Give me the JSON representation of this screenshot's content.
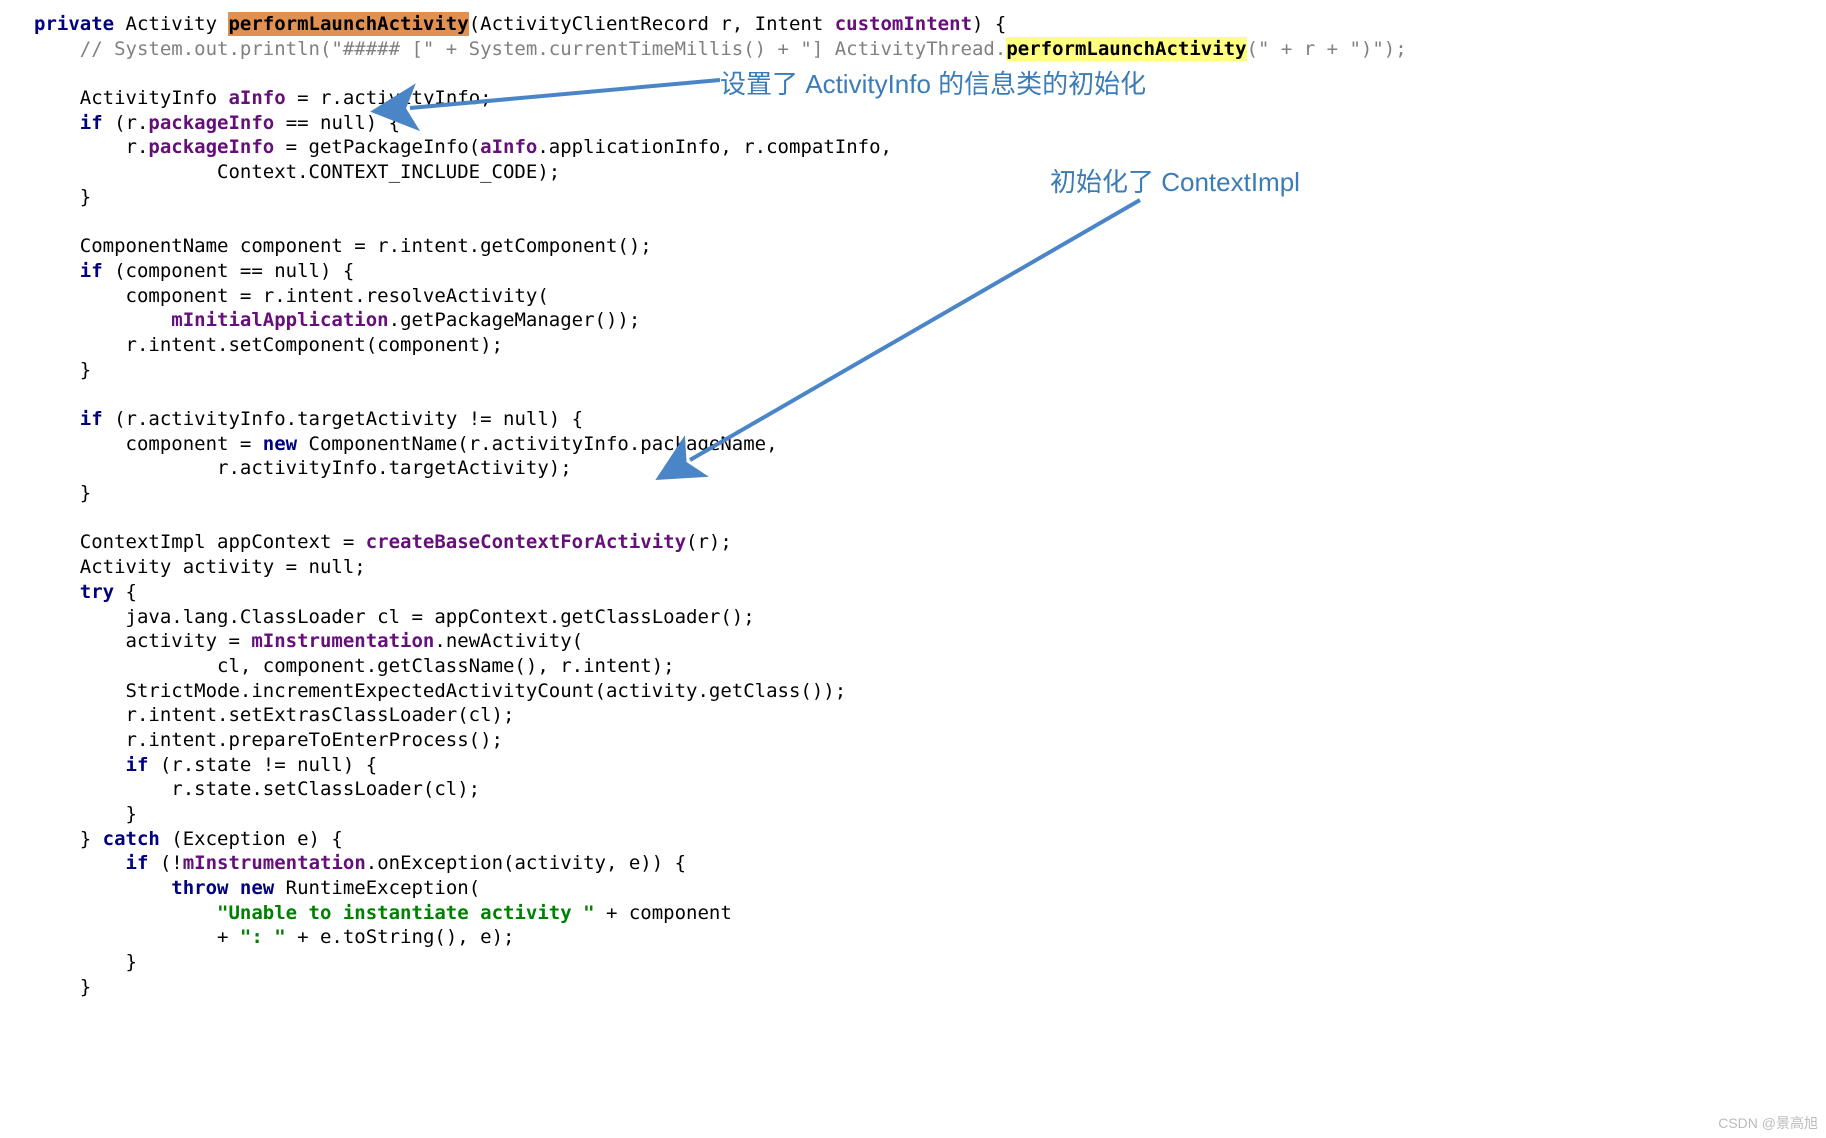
{
  "code": {
    "l1a": "private",
    "l1b": " Activity ",
    "l1c": "performLaunchActivity",
    "l1d": "(ActivityClientRecord r, Intent ",
    "l1e": "customIntent",
    "l1f": ") {",
    "l2a": "    // System.out.println(\"##### [\" + System.currentTimeMillis() + \"] ActivityThread.",
    "l2b": "performLaunchActivity",
    "l2c": "(\" + r + \")\");",
    "l3": "",
    "l4a": "    ActivityInfo ",
    "l4b": "aInfo",
    "l4c": " = r.activityInfo;",
    "l5a": "    ",
    "l5b": "if",
    "l5c": " (r.",
    "l5d": "packageInfo",
    "l5e": " == null) {",
    "l6a": "        r.",
    "l6b": "packageInfo",
    "l6c": " = getPackageInfo(",
    "l6d": "aInfo",
    "l6e": ".applicationInfo, r.compatInfo,",
    "l7": "                Context.CONTEXT_INCLUDE_CODE);",
    "l8": "    }",
    "l9": "",
    "l10": "    ComponentName component = r.intent.getComponent();",
    "l11a": "    ",
    "l11b": "if",
    "l11c": " (component == null) {",
    "l12": "        component = r.intent.resolveActivity(",
    "l13a": "            ",
    "l13b": "mInitialApplication",
    "l13c": ".getPackageManager());",
    "l14": "        r.intent.setComponent(component);",
    "l15": "    }",
    "l16": "",
    "l17a": "    ",
    "l17b": "if",
    "l17c": " (r.activityInfo.targetActivity != null) {",
    "l18a": "        component = ",
    "l18b": "new",
    "l18c": " ComponentName(r.activityInfo.packageName,",
    "l19": "                r.activityInfo.targetActivity);",
    "l20": "    }",
    "l21": "",
    "l22a": "    ContextImpl appContext = ",
    "l22b": "createBaseContextForActivity",
    "l22c": "(r);",
    "l23": "    Activity activity = null;",
    "l24a": "    ",
    "l24b": "try",
    "l24c": " {",
    "l25": "        java.lang.ClassLoader cl = appContext.getClassLoader();",
    "l26a": "        activity = ",
    "l26b": "mInstrumentation",
    "l26c": ".newActivity(",
    "l27": "                cl, component.getClassName(), r.intent);",
    "l28": "        StrictMode.incrementExpectedActivityCount(activity.getClass());",
    "l29": "        r.intent.setExtrasClassLoader(cl);",
    "l30": "        r.intent.prepareToEnterProcess();",
    "l31a": "        ",
    "l31b": "if",
    "l31c": " (r.state != null) {",
    "l32": "            r.state.setClassLoader(cl);",
    "l33": "        }",
    "l34a": "    } ",
    "l34b": "catch",
    "l34c": " (Exception e) {",
    "l35a": "        ",
    "l35b": "if",
    "l35c": " (!",
    "l35d": "mInstrumentation",
    "l35e": ".onException(activity, e)) {",
    "l36a": "            ",
    "l36b": "throw new",
    "l36c": " RuntimeException(",
    "l37a": "                ",
    "l37b": "\"Unable to instantiate activity \"",
    "l37c": " + component",
    "l38a": "                + ",
    "l38b": "\": \"",
    "l38c": " + e.toString(), e);",
    "l39": "        }",
    "l40": "    }"
  },
  "annotations": {
    "a1": "设置了 ActivityInfo 的信息类的初始化",
    "a2": "初始化了 ContextImpl"
  },
  "watermark": "CSDN @景高旭"
}
